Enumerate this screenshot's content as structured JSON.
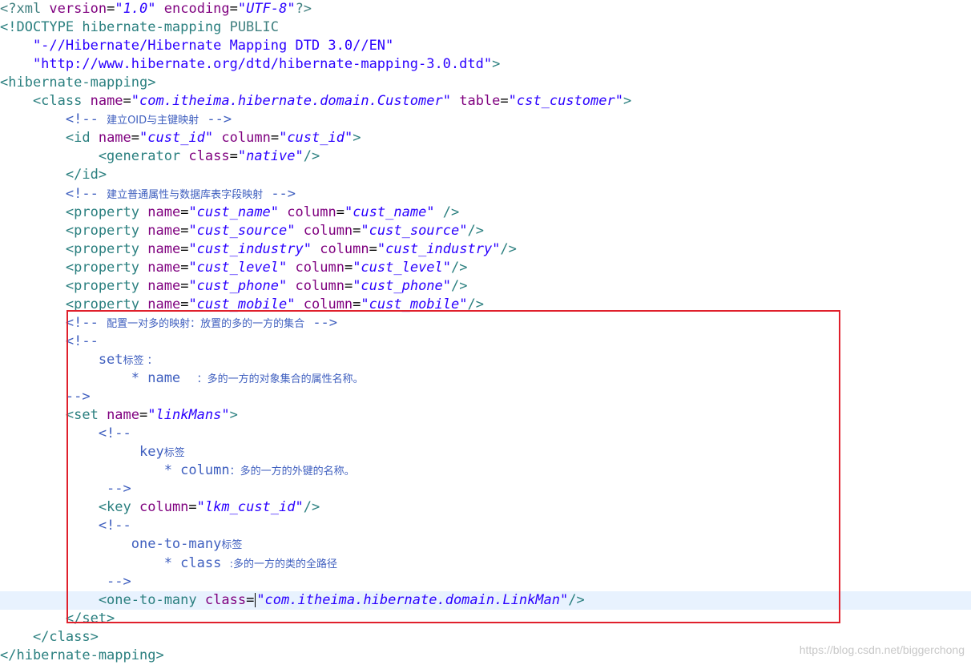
{
  "editor": {
    "lines": [
      {
        "segs": [
          [
            "<?xml ",
            "t-pi"
          ],
          [
            "version",
            "t-attr"
          ],
          [
            "=",
            "t-plain"
          ],
          [
            "\"1.0\"",
            "t-val"
          ],
          [
            " ",
            "t-plain"
          ],
          [
            "encoding",
            "t-attr"
          ],
          [
            "=",
            "t-plain"
          ],
          [
            "\"UTF-8\"",
            "t-val"
          ],
          [
            "?>",
            "t-pi"
          ]
        ]
      },
      {
        "segs": [
          [
            "<!DOCTYPE hibernate-mapping ",
            "t-tag"
          ],
          [
            "PUBLIC",
            "t-pi"
          ]
        ]
      },
      {
        "segs": [
          [
            "    \"-//Hibernate/Hibernate Mapping DTD 3.0//EN\"",
            "t-dt"
          ]
        ]
      },
      {
        "segs": [
          [
            "    \"http://www.hibernate.org/dtd/hibernate-mapping-3.0.dtd\"",
            "t-dt"
          ],
          [
            ">",
            "t-tag"
          ]
        ]
      },
      {
        "segs": [
          [
            "<hibernate-mapping>",
            "t-tag"
          ]
        ]
      },
      {
        "segs": [
          [
            "    <class ",
            "t-tag"
          ],
          [
            "name",
            "t-attr"
          ],
          [
            "=",
            "t-plain"
          ],
          [
            "\"com.itheima.hibernate.domain.Customer\"",
            "t-val"
          ],
          [
            " ",
            "t-plain"
          ],
          [
            "table",
            "t-attr"
          ],
          [
            "=",
            "t-plain"
          ],
          [
            "\"cst_customer\"",
            "t-val"
          ],
          [
            ">",
            "t-tag"
          ]
        ]
      },
      {
        "segs": [
          [
            "        <!-- ",
            "t-cm"
          ],
          [
            "建立OID与主键映射",
            "t-zh"
          ],
          [
            " -->",
            "t-cm"
          ]
        ]
      },
      {
        "segs": [
          [
            "        <id ",
            "t-tag"
          ],
          [
            "name",
            "t-attr"
          ],
          [
            "=",
            "t-plain"
          ],
          [
            "\"cust_id\"",
            "t-val"
          ],
          [
            " ",
            "t-plain"
          ],
          [
            "column",
            "t-attr"
          ],
          [
            "=",
            "t-plain"
          ],
          [
            "\"cust_id\"",
            "t-val"
          ],
          [
            ">",
            "t-tag"
          ]
        ]
      },
      {
        "segs": [
          [
            "            <generator ",
            "t-tag"
          ],
          [
            "class",
            "t-attr"
          ],
          [
            "=",
            "t-plain"
          ],
          [
            "\"native\"",
            "t-val"
          ],
          [
            "/>",
            "t-tag"
          ]
        ]
      },
      {
        "segs": [
          [
            "        </id>",
            "t-tag"
          ]
        ]
      },
      {
        "segs": [
          [
            "        <!-- ",
            "t-cm"
          ],
          [
            "建立普通属性与数据库表字段映射",
            "t-zh"
          ],
          [
            " -->",
            "t-cm"
          ]
        ]
      },
      {
        "segs": [
          [
            "        <property ",
            "t-tag"
          ],
          [
            "name",
            "t-attr"
          ],
          [
            "=",
            "t-plain"
          ],
          [
            "\"cust_name\"",
            "t-val"
          ],
          [
            " ",
            "t-plain"
          ],
          [
            "column",
            "t-attr"
          ],
          [
            "=",
            "t-plain"
          ],
          [
            "\"cust_name\"",
            "t-val"
          ],
          [
            " />",
            "t-tag"
          ]
        ]
      },
      {
        "segs": [
          [
            "        <property ",
            "t-tag"
          ],
          [
            "name",
            "t-attr"
          ],
          [
            "=",
            "t-plain"
          ],
          [
            "\"cust_source\"",
            "t-val"
          ],
          [
            " ",
            "t-plain"
          ],
          [
            "column",
            "t-attr"
          ],
          [
            "=",
            "t-plain"
          ],
          [
            "\"cust_source\"",
            "t-val"
          ],
          [
            "/>",
            "t-tag"
          ]
        ]
      },
      {
        "segs": [
          [
            "        <property ",
            "t-tag"
          ],
          [
            "name",
            "t-attr"
          ],
          [
            "=",
            "t-plain"
          ],
          [
            "\"cust_industry\"",
            "t-val"
          ],
          [
            " ",
            "t-plain"
          ],
          [
            "column",
            "t-attr"
          ],
          [
            "=",
            "t-plain"
          ],
          [
            "\"cust_industry\"",
            "t-val"
          ],
          [
            "/>",
            "t-tag"
          ]
        ]
      },
      {
        "segs": [
          [
            "        <property ",
            "t-tag"
          ],
          [
            "name",
            "t-attr"
          ],
          [
            "=",
            "t-plain"
          ],
          [
            "\"cust_level\"",
            "t-val"
          ],
          [
            " ",
            "t-plain"
          ],
          [
            "column",
            "t-attr"
          ],
          [
            "=",
            "t-plain"
          ],
          [
            "\"cust_level\"",
            "t-val"
          ],
          [
            "/>",
            "t-tag"
          ]
        ]
      },
      {
        "segs": [
          [
            "        <property ",
            "t-tag"
          ],
          [
            "name",
            "t-attr"
          ],
          [
            "=",
            "t-plain"
          ],
          [
            "\"cust_phone\"",
            "t-val"
          ],
          [
            " ",
            "t-plain"
          ],
          [
            "column",
            "t-attr"
          ],
          [
            "=",
            "t-plain"
          ],
          [
            "\"cust_phone\"",
            "t-val"
          ],
          [
            "/>",
            "t-tag"
          ]
        ]
      },
      {
        "segs": [
          [
            "        <property ",
            "t-tag"
          ],
          [
            "name",
            "t-attr"
          ],
          [
            "=",
            "t-plain"
          ],
          [
            "\"cust_mobile\"",
            "t-val"
          ],
          [
            " ",
            "t-plain"
          ],
          [
            "column",
            "t-attr"
          ],
          [
            "=",
            "t-plain"
          ],
          [
            "\"cust_mobile\"",
            "t-val"
          ],
          [
            "/>",
            "t-tag"
          ]
        ]
      },
      {
        "segs": [
          [
            "        <!-- ",
            "t-cm"
          ],
          [
            "配置一对多的映射：放置的多的一方的集合",
            "t-zh"
          ],
          [
            " -->",
            "t-cm"
          ]
        ]
      },
      {
        "segs": [
          [
            "        <!--",
            "t-cm"
          ]
        ]
      },
      {
        "segs": [
          [
            "            set",
            "t-cmk"
          ],
          [
            "标签 ：",
            "t-zh"
          ]
        ]
      },
      {
        "segs": [
          [
            "                * name  ",
            "t-cmk"
          ],
          [
            "：多的一方的对象集合的属性名称。",
            "t-zh"
          ]
        ]
      },
      {
        "segs": [
          [
            "        -->",
            "t-cm"
          ]
        ]
      },
      {
        "segs": [
          [
            "        <set ",
            "t-tag"
          ],
          [
            "name",
            "t-attr"
          ],
          [
            "=",
            "t-plain"
          ],
          [
            "\"linkMans\"",
            "t-val"
          ],
          [
            ">",
            "t-tag"
          ]
        ]
      },
      {
        "segs": [
          [
            "            <!--",
            "t-cm"
          ]
        ]
      },
      {
        "segs": [
          [
            "                 key",
            "t-cmk"
          ],
          [
            "标签",
            "t-zh"
          ]
        ]
      },
      {
        "segs": [
          [
            "                    * column",
            "t-cmk"
          ],
          [
            "：多的一方的外键的名称。",
            "t-zh"
          ]
        ]
      },
      {
        "segs": [
          [
            "             -->",
            "t-cm"
          ]
        ]
      },
      {
        "segs": [
          [
            "            <key ",
            "t-tag"
          ],
          [
            "column",
            "t-attr"
          ],
          [
            "=",
            "t-plain"
          ],
          [
            "\"lkm_cust_id\"",
            "t-val"
          ],
          [
            "/>",
            "t-tag"
          ]
        ]
      },
      {
        "segs": [
          [
            "            <!--",
            "t-cm"
          ]
        ]
      },
      {
        "segs": [
          [
            "                one-to-many",
            "t-cmk"
          ],
          [
            "标签",
            "t-zh"
          ]
        ]
      },
      {
        "segs": [
          [
            "                    * class ",
            "t-cmk"
          ],
          [
            ":多的一方的类的全路径",
            "t-zh"
          ]
        ]
      },
      {
        "segs": [
          [
            "             -->",
            "t-cm"
          ]
        ]
      },
      {
        "hl": true,
        "caretAfter": 2,
        "segs": [
          [
            "            <one-to-many ",
            "t-tag"
          ],
          [
            "class",
            "t-attr"
          ],
          [
            "=",
            "t-plain"
          ],
          [
            "\"com.itheima.hibernate.domain.LinkMan\"",
            "t-val"
          ],
          [
            "/>",
            "t-tag"
          ]
        ]
      },
      {
        "segs": [
          [
            "        </set>",
            "t-tag"
          ]
        ]
      },
      {
        "segs": [
          [
            "    </class>",
            "t-tag"
          ]
        ]
      },
      {
        "segs": [
          [
            "</hibernate-mapping>",
            "t-tag"
          ]
        ]
      }
    ]
  },
  "watermark": "https://blog.csdn.net/biggerchong"
}
